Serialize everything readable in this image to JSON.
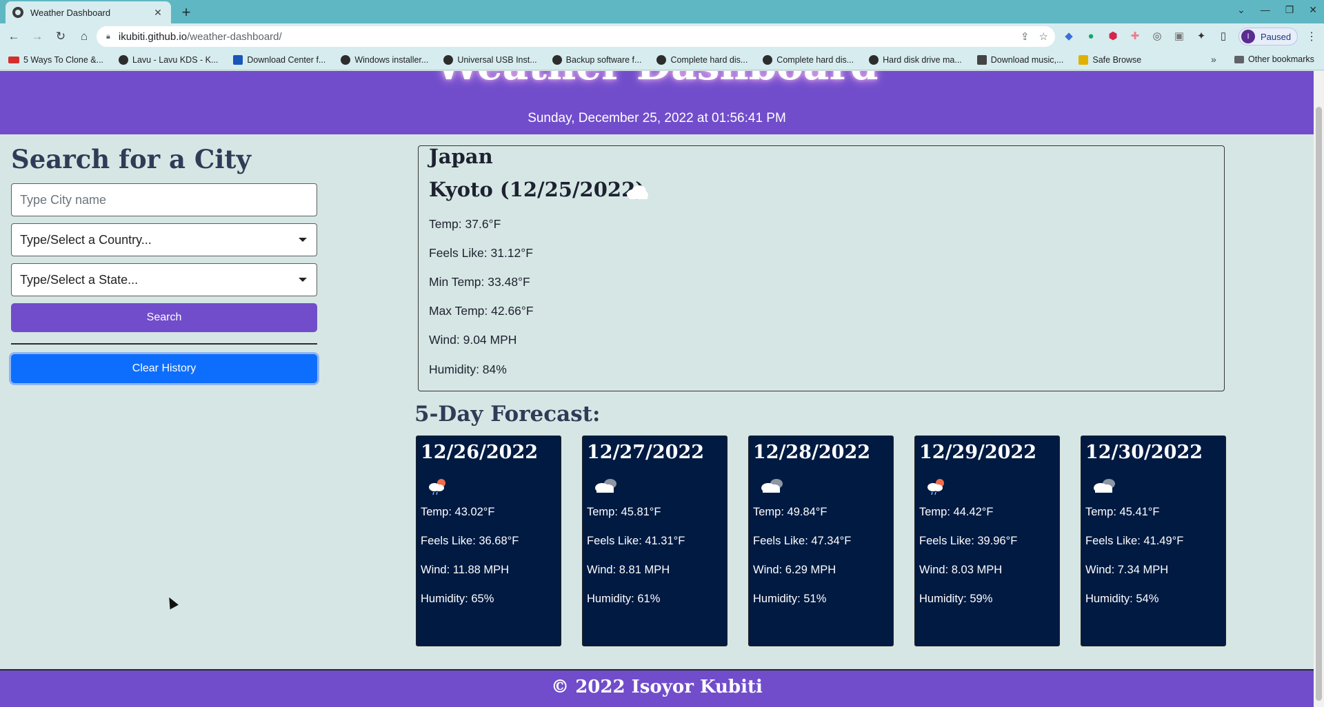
{
  "browser": {
    "tab_title": "Weather Dashboard",
    "url_host": "ikubiti.github.io",
    "url_path": "/weather-dashboard/",
    "profile_initial": "I",
    "profile_label": "Paused",
    "bookmarks": [
      "5 Ways To Clone &...",
      "Lavu - Lavu KDS - K...",
      "Download Center f...",
      "Windows installer...",
      "Universal USB Inst...",
      "Backup software f...",
      "Complete hard dis...",
      "Complete hard dis...",
      "Hard disk drive ma...",
      "Download music,...",
      "Safe Browse"
    ],
    "other_bookmarks": "Other bookmarks"
  },
  "header": {
    "title": "Weather Dashboard",
    "datetime": "Sunday, December 25, 2022 at 01:56:41 PM"
  },
  "sidebar": {
    "heading": "Search for a City",
    "city_placeholder": "Type City name",
    "country_placeholder": "Type/Select a Country...",
    "state_placeholder": "Type/Select a State...",
    "search_label": "Search",
    "clear_label": "Clear History"
  },
  "current": {
    "country": "Japan",
    "city_date": "Kyoto (12/25/2022)",
    "icon": "cloud-icon",
    "temp": "Temp: 37.6°F",
    "feels_like": "Feels Like: 31.12°F",
    "min_temp": "Min Temp: 33.48°F",
    "max_temp": "Max Temp: 42.66°F",
    "wind": "Wind: 9.04 MPH",
    "humidity": "Humidity: 84%"
  },
  "forecast": {
    "heading": "5-Day Forecast:",
    "days": [
      {
        "date": "12/26/2022",
        "icon": "rain-sun-icon",
        "temp": "Temp: 43.02°F",
        "feels_like": "Feels Like: 36.68°F",
        "wind": "Wind: 11.88 MPH",
        "humidity": "Humidity: 65%"
      },
      {
        "date": "12/27/2022",
        "icon": "clouds-icon",
        "temp": "Temp: 45.81°F",
        "feels_like": "Feels Like: 41.31°F",
        "wind": "Wind: 8.81 MPH",
        "humidity": "Humidity: 61%"
      },
      {
        "date": "12/28/2022",
        "icon": "clouds-icon",
        "temp": "Temp: 49.84°F",
        "feels_like": "Feels Like: 47.34°F",
        "wind": "Wind: 6.29 MPH",
        "humidity": "Humidity: 51%"
      },
      {
        "date": "12/29/2022",
        "icon": "rain-sun-icon",
        "temp": "Temp: 44.42°F",
        "feels_like": "Feels Like: 39.96°F",
        "wind": "Wind: 8.03 MPH",
        "humidity": "Humidity: 59%"
      },
      {
        "date": "12/30/2022",
        "icon": "clouds-icon",
        "temp": "Temp: 45.41°F",
        "feels_like": "Feels Like: 41.49°F",
        "wind": "Wind: 7.34 MPH",
        "humidity": "Humidity: 54%"
      }
    ]
  },
  "footer": {
    "text": "© 2022 Isoyor Kubiti"
  },
  "colors": {
    "header_bg": "#714dcb",
    "card_bg": "#001a42",
    "clear_button": "#0d6efd",
    "page_bg": "#d6e6e4"
  }
}
